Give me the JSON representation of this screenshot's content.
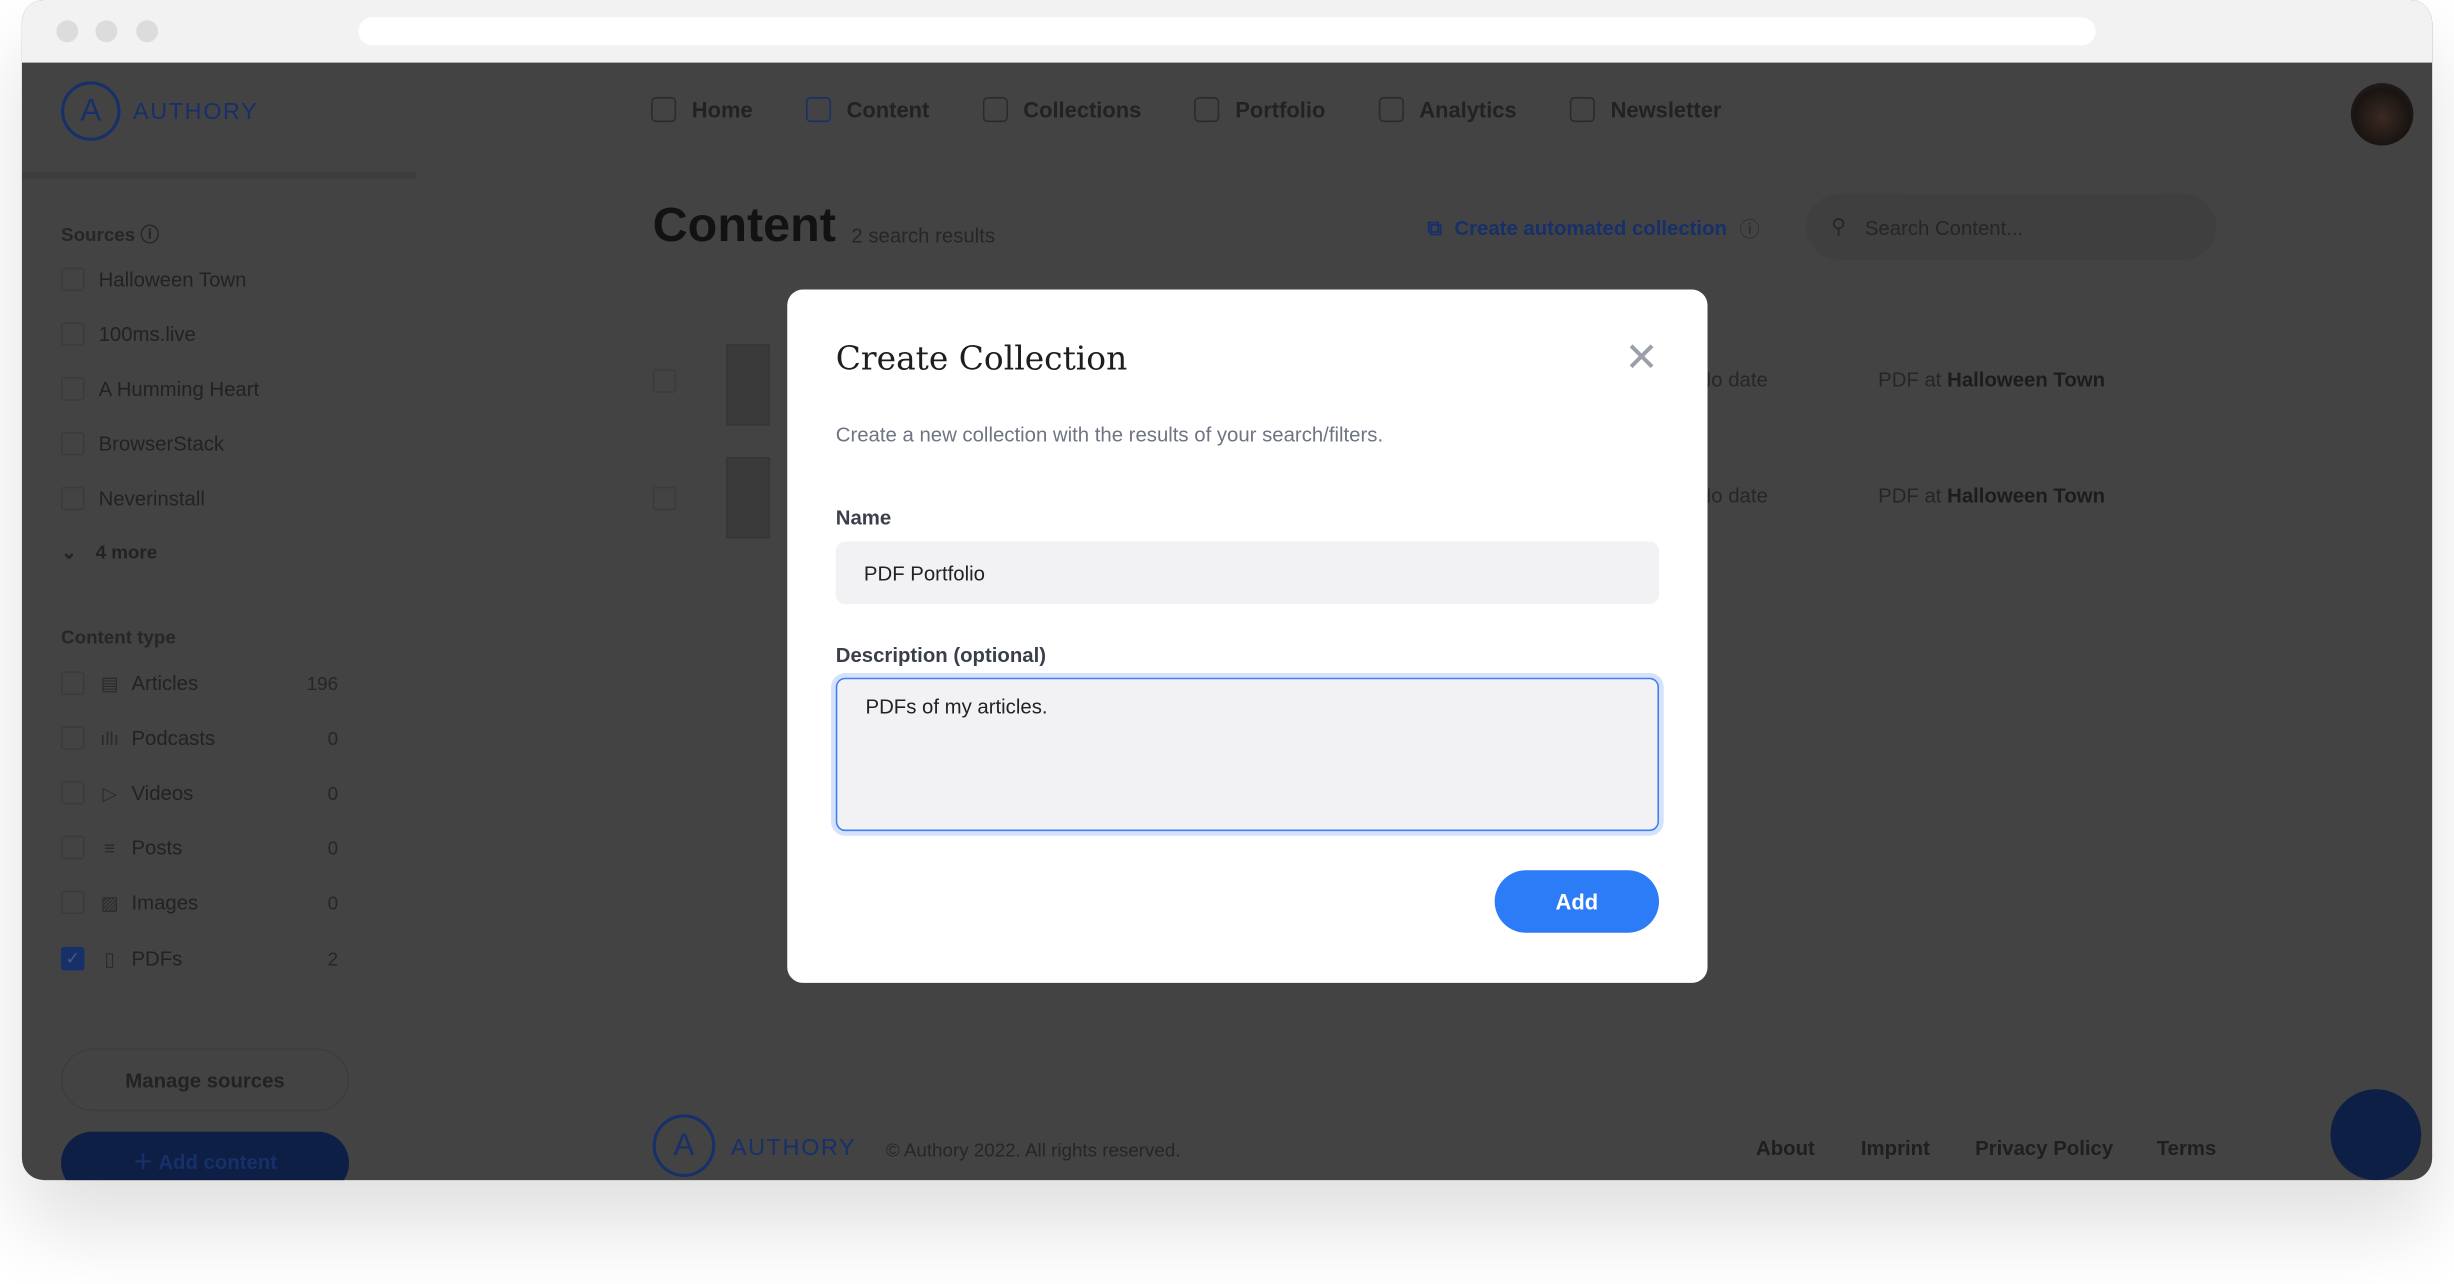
{
  "brand": {
    "name": "AUTHORY"
  },
  "nav": {
    "items": [
      {
        "label": "Home",
        "icon": "home-icon"
      },
      {
        "label": "Content",
        "icon": "document-icon",
        "active": true
      },
      {
        "label": "Collections",
        "icon": "collections-icon"
      },
      {
        "label": "Portfolio",
        "icon": "portfolio-icon"
      },
      {
        "label": "Analytics",
        "icon": "bar-chart-icon"
      },
      {
        "label": "Newsletter",
        "icon": "mail-icon"
      }
    ]
  },
  "sidebar": {
    "sources_title": "Sources",
    "sources": [
      "Halloween Town",
      "100ms.live",
      "A Humming Heart",
      "BrowserStack",
      "Neverinstall"
    ],
    "more": "4 more",
    "content_type_title": "Content type",
    "types": [
      {
        "label": "Articles",
        "count": "196",
        "checked": false
      },
      {
        "label": "Podcasts",
        "count": "0",
        "checked": false
      },
      {
        "label": "Videos",
        "count": "0",
        "checked": false
      },
      {
        "label": "Posts",
        "count": "0",
        "checked": false
      },
      {
        "label": "Images",
        "count": "0",
        "checked": false
      },
      {
        "label": "PDFs",
        "count": "2",
        "checked": true
      }
    ],
    "manage_sources": "Manage sources",
    "add_content": "Add content"
  },
  "main": {
    "title": "Content",
    "subtitle": "2 search results",
    "create_automated": "Create automated collection",
    "search_placeholder": "Search Content...",
    "results": [
      {
        "date": "No date",
        "type": "PDF at",
        "source": "Halloween Town"
      },
      {
        "date": "No date",
        "type": "PDF at",
        "source": "Halloween Town"
      }
    ]
  },
  "footer": {
    "copyright": "© Authory 2022. All rights reserved.",
    "links": [
      "About",
      "Imprint",
      "Privacy Policy",
      "Terms"
    ]
  },
  "modal": {
    "title": "Create Collection",
    "description": "Create a new collection with the results of your search/filters.",
    "name_label": "Name",
    "name_value": "PDF Portfolio",
    "desc_label": "Description (optional)",
    "desc_value": "PDFs of my articles.",
    "add": "Add"
  },
  "colors": {
    "accent": "#2d7cf7",
    "brand": "#17306a",
    "overlay": "#434343"
  }
}
